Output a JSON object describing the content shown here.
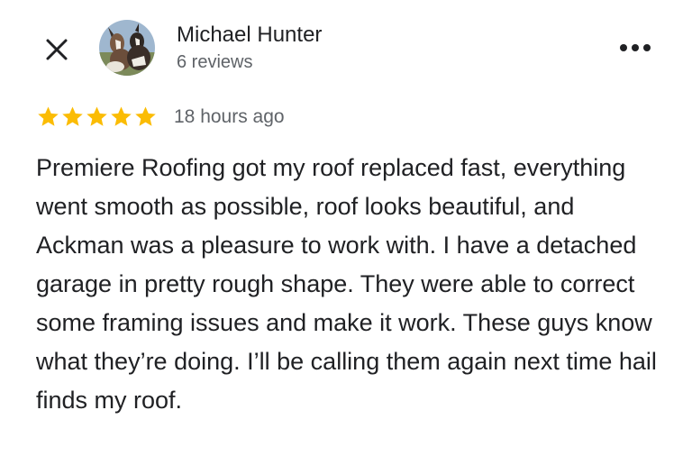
{
  "header": {
    "close_icon": "close-icon",
    "more_icon": "more-options-icon"
  },
  "reviewer": {
    "name": "Michael Hunter",
    "review_count": "6 reviews",
    "avatar": "profile photo with goats"
  },
  "review": {
    "rating": 5,
    "max_rating": 5,
    "star_color": "#fbbc04",
    "timestamp": "18 hours ago",
    "text": "Premiere Roofing got my roof replaced fast, everything went smooth as possible, roof looks beautiful, and Ackman was a pleasure to work with. I have a detached garage in pretty rough shape. They were able to correct some framing issues and make it work. These guys know what they’re doing. I’ll be calling them again next time hail finds my roof."
  }
}
